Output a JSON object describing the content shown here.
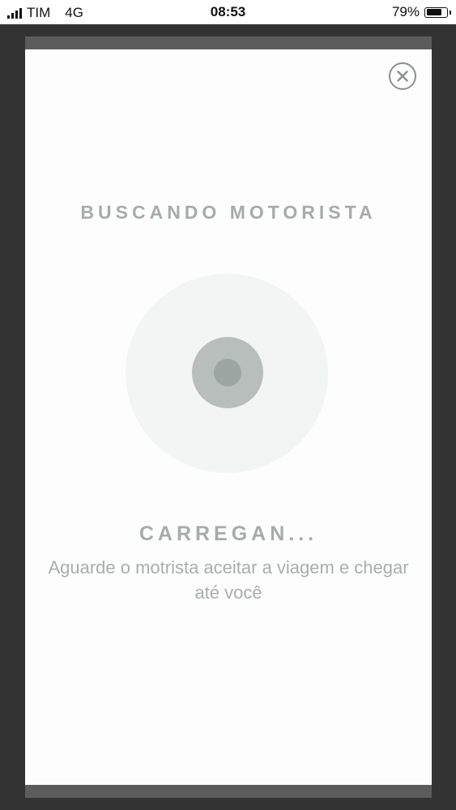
{
  "status_bar": {
    "carrier": "TIM",
    "network": "4G",
    "time": "08:53",
    "battery_percent": "79%",
    "battery_level": 0.79,
    "signal_bars": 4
  },
  "modal": {
    "title": "BUSCANDO MOTORISTA",
    "loading_text": "CARREGAN...",
    "subtitle": "Aguarde o motrista aceitar a viagem e chegar até você",
    "close_icon": "close-icon"
  },
  "colors": {
    "backdrop": "#333333",
    "modal_background": "#fdfdfd",
    "text_gray": "#a5acaa",
    "radar_outer": "#f3f4f4",
    "radar_mid": "#b7bebc",
    "radar_dot": "#9ea6a4"
  }
}
